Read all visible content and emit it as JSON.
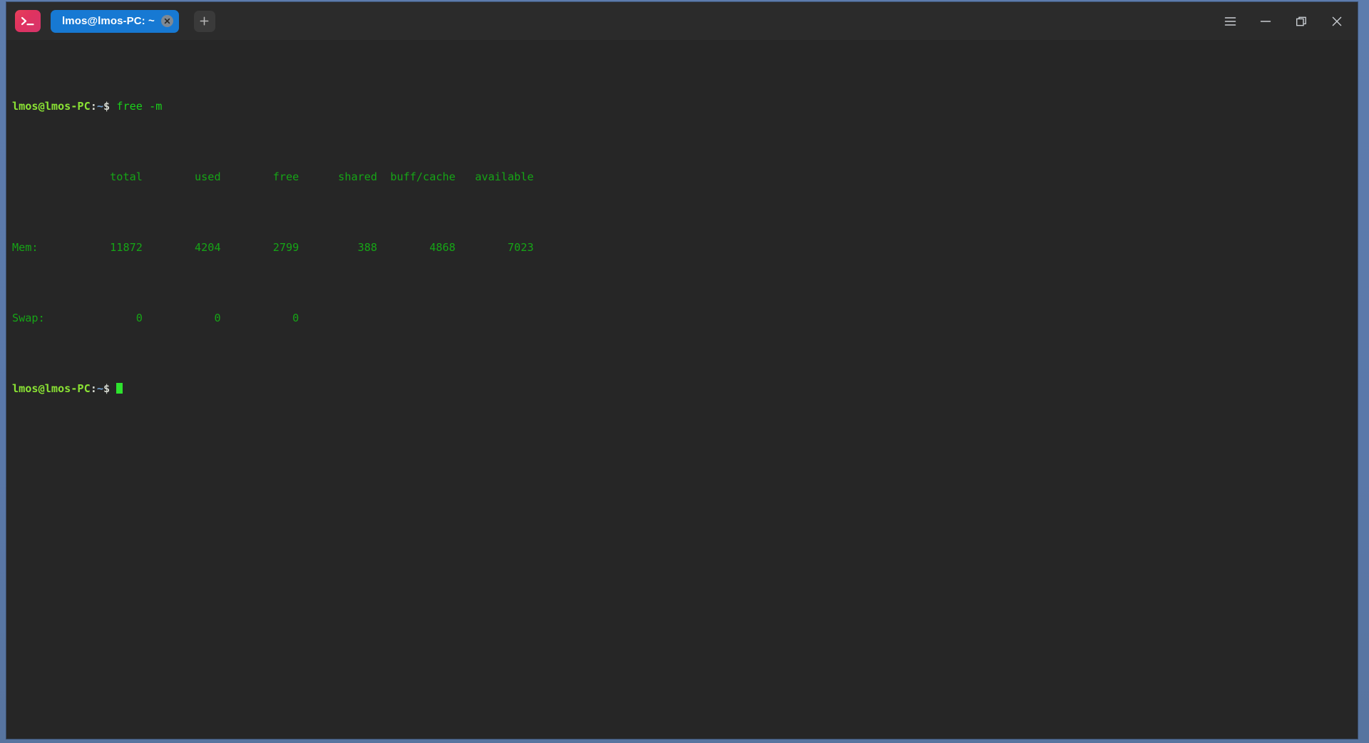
{
  "window": {
    "app_icon_name": "terminal-prompt-icon",
    "accent_color": "#1779d3",
    "titlebar_bg": "#2b2b2b",
    "terminal_bg": "#262626",
    "desktop_bg": "#5a7bb0",
    "prompt_green": "#8ae234",
    "output_green": "#16a516"
  },
  "tabs": [
    {
      "label": "lmos@lmos-PC: ~",
      "active": true,
      "close_label": "×"
    }
  ],
  "new_tab_button": {
    "label": "+",
    "tooltip": "New Tab"
  },
  "window_controls": {
    "menu": "≡",
    "minimize": "–",
    "maximize": "□",
    "close": "×"
  },
  "terminal": {
    "prompt": {
      "user_host": "lmos@lmos-PC",
      "colon": ":",
      "path": "~",
      "sigil": "$"
    },
    "command": "free -m",
    "columns": [
      "total",
      "used",
      "free",
      "shared",
      "buff/cache",
      "available"
    ],
    "rows": [
      {
        "label": "Mem:",
        "values": [
          "11872",
          "4204",
          "2799",
          "388",
          "4868",
          "7023"
        ]
      },
      {
        "label": "Swap:",
        "values": [
          "0",
          "0",
          "0",
          "",
          "",
          ""
        ]
      }
    ],
    "raw_lines": [
      "               total        used        free      shared  buff/cache   available",
      "Mem:           11872        4204        2799         388        4868        7023",
      "Swap:              0           0           0"
    ],
    "cursor_visible": true
  }
}
